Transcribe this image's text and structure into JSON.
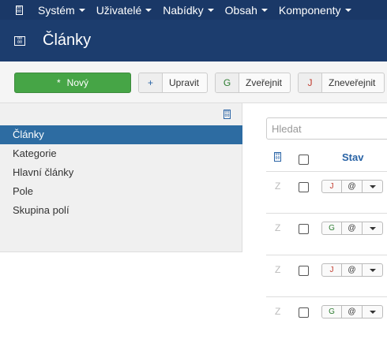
{
  "topnav": {
    "logo_glyph": "⎖",
    "menu": [
      {
        "label": "Systém"
      },
      {
        "label": "Uživatelé"
      },
      {
        "label": "Nabídky"
      },
      {
        "label": "Obsah"
      },
      {
        "label": "Komponenty"
      }
    ]
  },
  "header": {
    "title": "Články"
  },
  "toolbar": {
    "new_icon": "*",
    "new_label": "Nový",
    "edit_icon": "+",
    "edit_label": "Upravit",
    "publish_icon": "G",
    "publish_label": "Zveřejnit",
    "unpublish_icon": "J",
    "unpublish_label": "Zneveřejnit"
  },
  "sidebar": {
    "items": [
      {
        "label": "Články",
        "active": true
      },
      {
        "label": "Kategorie"
      },
      {
        "label": "Hlavní články"
      },
      {
        "label": "Pole"
      },
      {
        "label": "Skupina polí"
      }
    ]
  },
  "search": {
    "placeholder": "Hledat"
  },
  "table": {
    "status_header": "Stav",
    "rows": [
      {
        "drag": "Z",
        "status_icon": "J",
        "status": "unpublished",
        "at": "@"
      },
      {
        "drag": "Z",
        "status_icon": "G",
        "status": "published",
        "at": "@"
      },
      {
        "drag": "Z",
        "status_icon": "J",
        "status": "unpublished",
        "at": "@"
      },
      {
        "drag": "Z",
        "status_icon": "G",
        "status": "published",
        "at": "@"
      }
    ]
  },
  "colors": {
    "topnav_bg": "#1a3867",
    "header_bg": "#1c3d6e",
    "new_button": "#46a546",
    "active_nav": "#2d6ca2",
    "link_blue": "#2a64a6"
  }
}
